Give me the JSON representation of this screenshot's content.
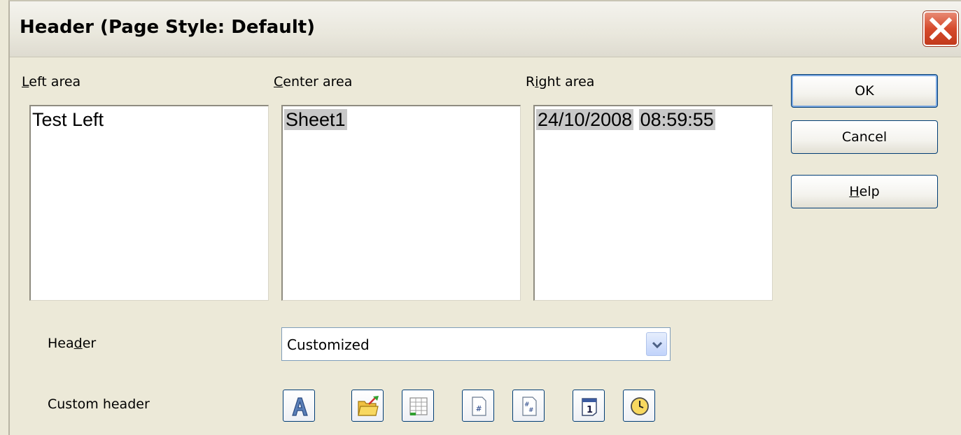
{
  "dialog": {
    "title": "Header (Page Style: Default)",
    "close_icon": "close-icon"
  },
  "areas": {
    "left": {
      "label_first": "L",
      "label_rest": "eft area",
      "content": "Test Left"
    },
    "center": {
      "label_first": "C",
      "label_rest": "enter area",
      "content": "Sheet1"
    },
    "right": {
      "label_first": "R",
      "label_mid": "i",
      "label_rest": "ght area",
      "date": "24/10/2008",
      "time": "08:59:55"
    }
  },
  "buttons": {
    "ok": "OK",
    "cancel": "Cancel",
    "help_first": "H",
    "help_rest": "elp"
  },
  "header": {
    "label_a": "Hea",
    "label_u": "d",
    "label_b": "er",
    "selected": "Customized"
  },
  "custom_header": {
    "label": "Custom header",
    "tools": [
      "text-attributes-icon",
      "file-name-icon",
      "sheet-name-icon",
      "page-icon",
      "pages-icon",
      "date-icon",
      "time-icon"
    ]
  },
  "colors": {
    "dialog_bg": "#ece9d8",
    "field_highlight": "#c8c8c8",
    "button_border": "#003c74",
    "close_red": "#d64a2c"
  }
}
